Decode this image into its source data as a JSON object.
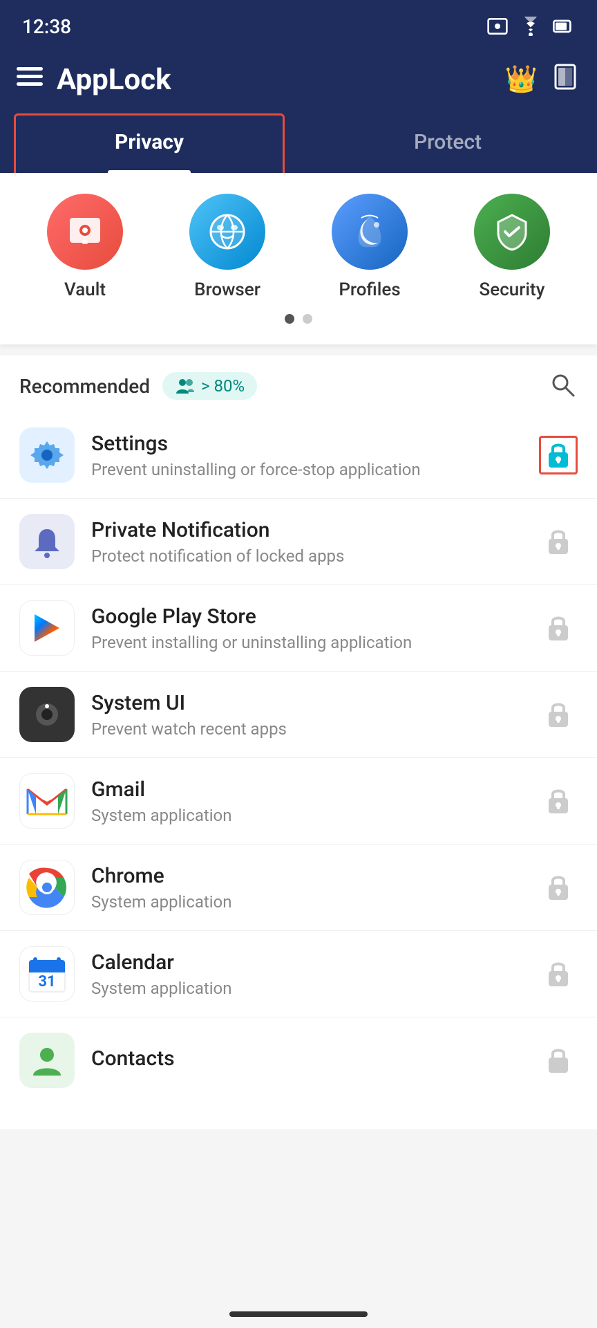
{
  "statusBar": {
    "time": "12:38"
  },
  "appBar": {
    "title": "AppLock"
  },
  "tabs": [
    {
      "id": "privacy",
      "label": "Privacy",
      "active": true
    },
    {
      "id": "protect",
      "label": "Protect",
      "active": false
    }
  ],
  "features": [
    {
      "id": "vault",
      "label": "Vault",
      "bg": "vault-bg",
      "icon": "🔐"
    },
    {
      "id": "browser",
      "label": "Browser",
      "bg": "browser-bg",
      "icon": "🎭"
    },
    {
      "id": "profiles",
      "label": "Profiles",
      "bg": "profiles-bg",
      "icon": "🌙"
    },
    {
      "id": "security",
      "label": "Security",
      "bg": "security-bg",
      "icon": "🛡"
    }
  ],
  "recommended": {
    "label": "Recommended",
    "badge": "> 80%"
  },
  "appList": [
    {
      "id": "settings",
      "name": "Settings",
      "desc": "Prevent uninstalling or force-stop application",
      "iconType": "settings",
      "locked": true
    },
    {
      "id": "private-notification",
      "name": "Private Notification",
      "desc": "Protect notification of locked apps",
      "iconType": "notification",
      "locked": false
    },
    {
      "id": "google-play-store",
      "name": "Google Play Store",
      "desc": "Prevent installing or uninstalling application",
      "iconType": "playstore",
      "locked": false
    },
    {
      "id": "system-ui",
      "name": "System UI",
      "desc": "Prevent watch recent apps",
      "iconType": "systemui",
      "locked": false
    },
    {
      "id": "gmail",
      "name": "Gmail",
      "desc": "System application",
      "iconType": "gmail",
      "locked": false
    },
    {
      "id": "chrome",
      "name": "Chrome",
      "desc": "System application",
      "iconType": "chrome",
      "locked": false
    },
    {
      "id": "calendar",
      "name": "Calendar",
      "desc": "System application",
      "iconType": "calendar",
      "locked": false
    },
    {
      "id": "contacts",
      "name": "Contacts",
      "desc": "System application",
      "iconType": "contacts",
      "locked": false
    }
  ]
}
